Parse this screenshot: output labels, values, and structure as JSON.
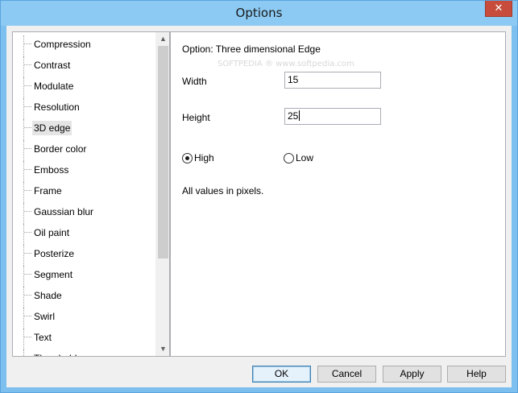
{
  "window": {
    "title": "Options",
    "close_glyph": "✕"
  },
  "tree": {
    "items": [
      {
        "label": "Compression"
      },
      {
        "label": "Contrast"
      },
      {
        "label": "Modulate"
      },
      {
        "label": "Resolution"
      },
      {
        "label": "3D edge",
        "selected": true
      },
      {
        "label": "Border color"
      },
      {
        "label": "Emboss"
      },
      {
        "label": "Frame"
      },
      {
        "label": "Gaussian blur"
      },
      {
        "label": "Oil paint"
      },
      {
        "label": "Posterize"
      },
      {
        "label": "Segment"
      },
      {
        "label": "Shade"
      },
      {
        "label": "Swirl"
      },
      {
        "label": "Text"
      },
      {
        "label": "Threshold"
      }
    ],
    "scroll_up_glyph": "▲",
    "scroll_down_glyph": "▼"
  },
  "panel": {
    "option_title": "Option: Three dimensional  Edge",
    "watermark": "SOFTPEDIA ® www.softpedia.com",
    "width_label": "Width",
    "width_value": "15",
    "height_label": "Height",
    "height_value": "25",
    "radio_high": "High",
    "radio_low": "Low",
    "selected_quality": "High",
    "note": "All values in pixels."
  },
  "buttons": {
    "ok": "OK",
    "cancel": "Cancel",
    "apply": "Apply",
    "help": "Help"
  },
  "colors": {
    "title_bar": "#8ccaf3",
    "close_button": "#c74c3c",
    "selection": "#e5e5e5"
  }
}
